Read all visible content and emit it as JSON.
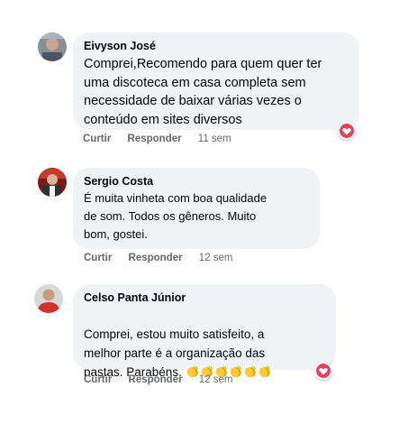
{
  "comments": [
    {
      "author": "Eivyson José",
      "text": "Comprei,Recomendo para quem quer ter\numa discoteca em casa completa sem\nnecessidade de baixar várias vezes o\nconteúdo em sites diversos",
      "like_label": "Curtir",
      "reply_label": "Responder",
      "time": "11 sem",
      "reaction": "heart-icon"
    },
    {
      "author": "Sergio Costa",
      "text": "É muita vinheta com boa qualidade\nde som. Todos os gêneros. Muito\nbom, gostei.",
      "like_label": "Curtir",
      "reply_label": "Responder",
      "time": "12 sem"
    },
    {
      "author": "Celso Panta Júnior",
      "text": "Comprei, estou muito satisfeito, a\nmelhor parte é a organização das\npastas. Parabéns.",
      "emojis": [
        "clapping-hands-icon",
        "clapping-hands-icon",
        "clapping-hands-icon",
        "clapping-hands-icon",
        "clapping-hands-icon",
        "clapping-hands-icon"
      ],
      "like_label": "Curtir",
      "reply_label": "Responder",
      "time": "12 sem",
      "reaction": "heart-icon"
    }
  ],
  "colors": {
    "bubble": "#f0f2f5",
    "meta": "#65676b",
    "heart": "#e4405f"
  }
}
